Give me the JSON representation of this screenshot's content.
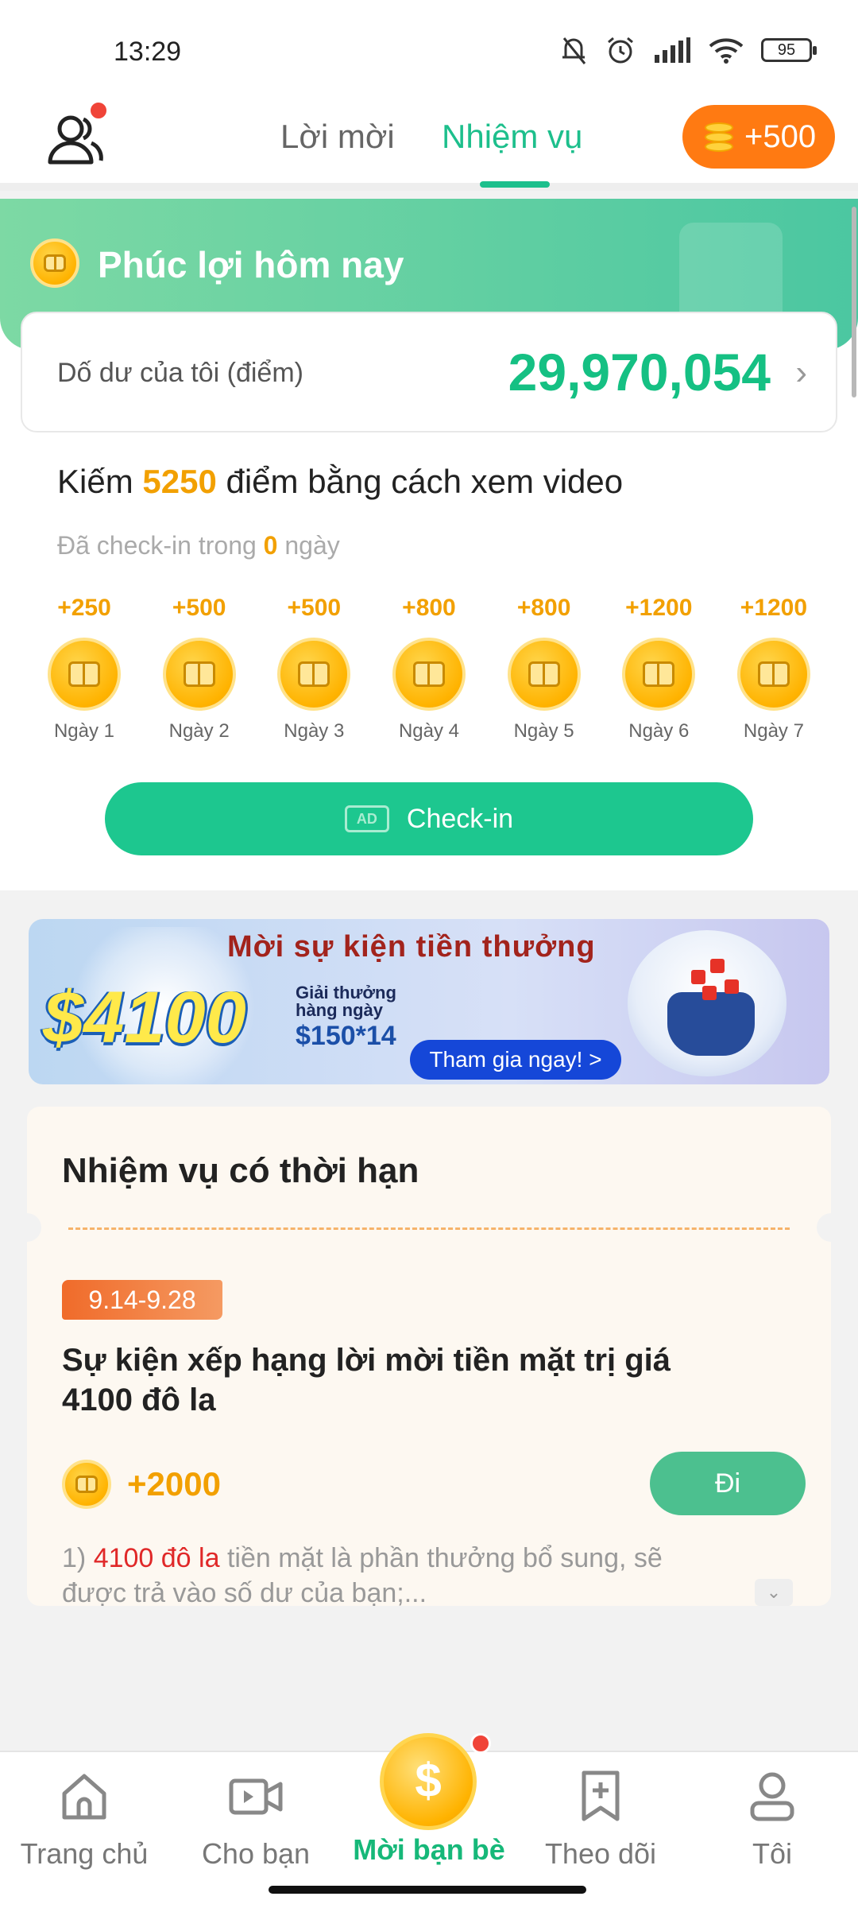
{
  "status_bar": {
    "time": "13:29",
    "battery": "95"
  },
  "header": {
    "tabs": [
      {
        "label": "Lời mời",
        "active": false
      },
      {
        "label": "Nhiệm vụ",
        "active": true
      }
    ],
    "coin_button_label": "+500"
  },
  "welfare": {
    "title": "Phúc lợi hôm nay",
    "balance_label": "Dố dư của tôi (điểm)",
    "balance_value": "29,970,054",
    "earn_prefix": "Kiếm",
    "earn_amount": "5250",
    "earn_suffix": "điểm bằng cách xem video",
    "checked_prefix": "Đã check-in trong",
    "checked_days": "0",
    "checked_suffix": "ngày",
    "days": [
      {
        "reward": "+250",
        "label": "Ngày 1"
      },
      {
        "reward": "+500",
        "label": "Ngày 2"
      },
      {
        "reward": "+500",
        "label": "Ngày 3"
      },
      {
        "reward": "+800",
        "label": "Ngày 4"
      },
      {
        "reward": "+800",
        "label": "Ngày 5"
      },
      {
        "reward": "+1200",
        "label": "Ngày 6"
      },
      {
        "reward": "+1200",
        "label": "Ngày 7"
      }
    ],
    "ad_badge": "AD",
    "checkin_label": "Check-in"
  },
  "banner": {
    "title": "Mời sự kiện tiền thưởng",
    "amount": "$4100",
    "daily_label": "Giải thưởng hàng ngày",
    "per_day": "$150*14",
    "join_label": "Tham gia ngay! >"
  },
  "limited_tasks": {
    "heading": "Nhiệm vụ có thời hạn",
    "date_range": "9.14-9.28",
    "title": "Sự kiện xếp hạng lời mời tiền mặt trị giá 4100 đô la",
    "reward": "+2000",
    "go_label": "Đi",
    "desc_prefix": "1)",
    "desc_highlight": "4100 đô la",
    "desc_rest": "tiền mặt là phần thưởng bổ sung, sẽ được trả vào số dư của bạn;..."
  },
  "bottom_nav": [
    {
      "label": "Trang chủ",
      "icon": "home-icon",
      "active": false
    },
    {
      "label": "Cho bạn",
      "icon": "video-icon",
      "active": false
    },
    {
      "label": "Mời bạn bè",
      "icon": "dollar-coin-icon",
      "active": true
    },
    {
      "label": "Theo dõi",
      "icon": "bookmark-add-icon",
      "active": false
    },
    {
      "label": "Tôi",
      "icon": "profile-icon",
      "active": false
    }
  ],
  "colors": {
    "accent": "#1dbf8c",
    "coin_orange": "#ff7a12",
    "reward_orange": "#f2a000",
    "highlight_red": "#e02828"
  }
}
